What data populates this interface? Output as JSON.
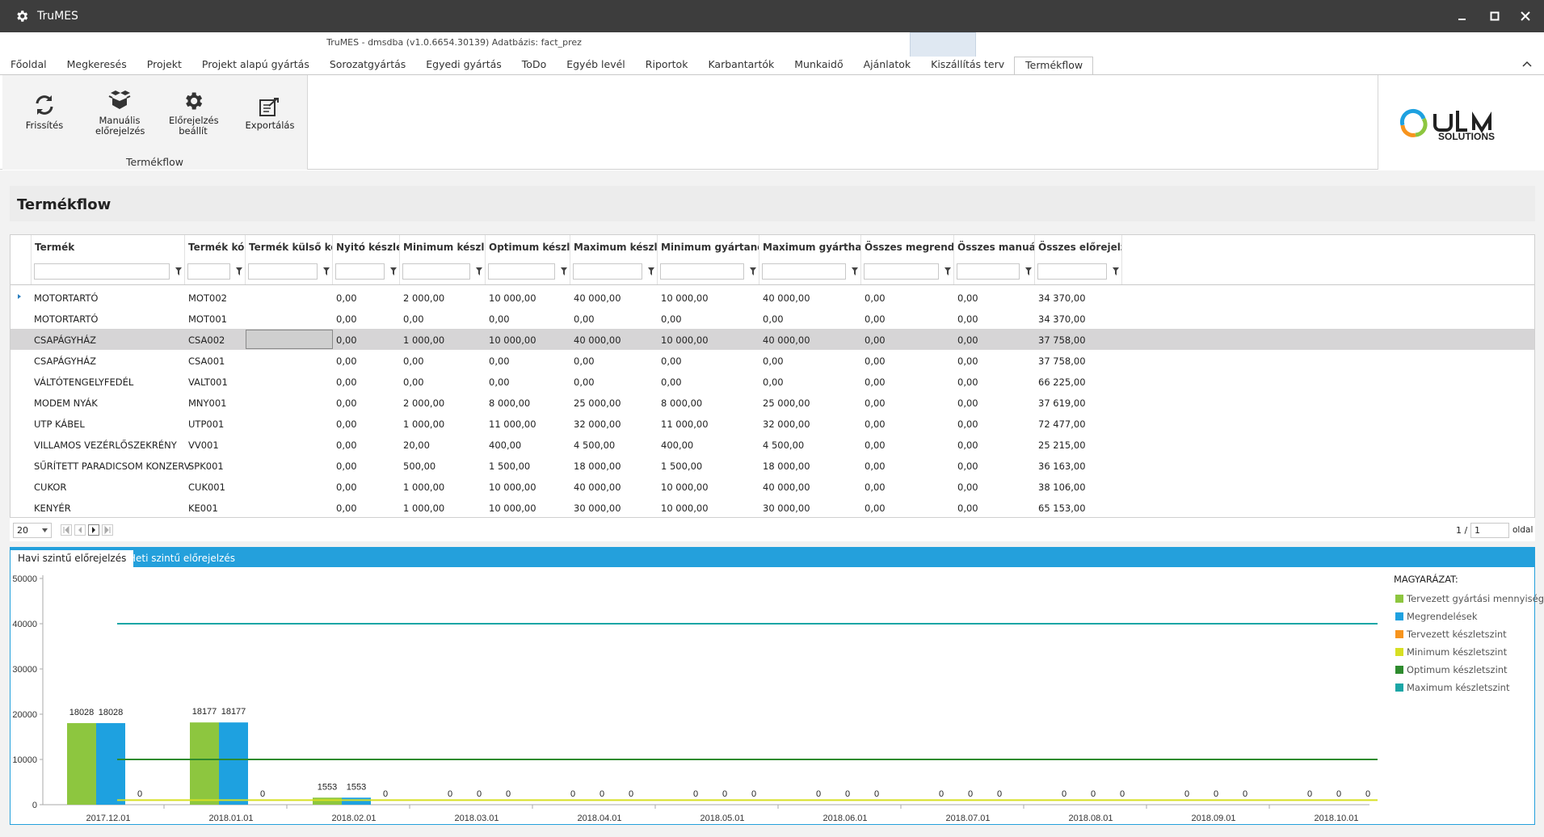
{
  "window": {
    "title": "TruMES"
  },
  "app_subtitle": "TruMES - dmsdba (v1.0.6654.30139) Adatbázis: fact_prez",
  "tabs": [
    {
      "label": "Főoldal"
    },
    {
      "label": "Megkeresés"
    },
    {
      "label": "Projekt"
    },
    {
      "label": "Projekt alapú gyártás"
    },
    {
      "label": "Sorozatgyártás"
    },
    {
      "label": "Egyedi gyártás"
    },
    {
      "label": "ToDo"
    },
    {
      "label": "Egyéb levél"
    },
    {
      "label": "Riportok"
    },
    {
      "label": "Karbantartók"
    },
    {
      "label": "Munkaidő"
    },
    {
      "label": "Ajánlatok"
    },
    {
      "label": "Kiszállítás terv"
    },
    {
      "label": "Termékflow"
    }
  ],
  "active_tab": "Termékflow",
  "ribbon": {
    "buttons": [
      {
        "label": "Frissítés",
        "icon": "refresh-icon"
      },
      {
        "label": "Manuális előrejelzés",
        "icon": "boxes-icon"
      },
      {
        "label": "Előrejelzés beállít",
        "icon": "gear-icon"
      },
      {
        "label": "Exportálás",
        "icon": "export-icon"
      }
    ],
    "group_label": "Termékflow"
  },
  "logo": {
    "text": "SOLUTIONS"
  },
  "panel": {
    "title": "Termékflow"
  },
  "grid": {
    "columns": [
      "Termék",
      "Termék kód",
      "Termék külső kód",
      "Nyitó készlet",
      "Minimum készlet",
      "Optimum készlet",
      "Maximum készlet",
      "Minimum gyártandó",
      "Maximum gyártható",
      "Összes megrendelt",
      "Összes manuális",
      "Összes előrejelzés"
    ],
    "rows": [
      [
        "MOTORTARTÓ",
        "MOT002",
        "",
        "0,00",
        "2 000,00",
        "10 000,00",
        "40 000,00",
        "10 000,00",
        "40 000,00",
        "0,00",
        "0,00",
        "34 370,00"
      ],
      [
        "MOTORTARTÓ",
        "MOT001",
        "",
        "0,00",
        "0,00",
        "0,00",
        "0,00",
        "0,00",
        "0,00",
        "0,00",
        "0,00",
        "34 370,00"
      ],
      [
        "CSAPÁGYHÁZ",
        "CSA002",
        "",
        "0,00",
        "1 000,00",
        "10 000,00",
        "40 000,00",
        "10 000,00",
        "40 000,00",
        "0,00",
        "0,00",
        "37 758,00"
      ],
      [
        "CSAPÁGYHÁZ",
        "CSA001",
        "",
        "0,00",
        "0,00",
        "0,00",
        "0,00",
        "0,00",
        "0,00",
        "0,00",
        "0,00",
        "37 758,00"
      ],
      [
        "VÁLTÓTENGELYFEDÉL",
        "VALT001",
        "",
        "0,00",
        "0,00",
        "0,00",
        "0,00",
        "0,00",
        "0,00",
        "0,00",
        "0,00",
        "66 225,00"
      ],
      [
        "MODEM NYÁK",
        "MNY001",
        "",
        "0,00",
        "2 000,00",
        "8 000,00",
        "25 000,00",
        "8 000,00",
        "25 000,00",
        "0,00",
        "0,00",
        "37 619,00"
      ],
      [
        "UTP KÁBEL",
        "UTP001",
        "",
        "0,00",
        "1 000,00",
        "11 000,00",
        "32 000,00",
        "11 000,00",
        "32 000,00",
        "0,00",
        "0,00",
        "72 477,00"
      ],
      [
        "VILLAMOS VEZÉRLŐSZEKRÉNY",
        "VV001",
        "",
        "0,00",
        "20,00",
        "400,00",
        "4 500,00",
        "400,00",
        "4 500,00",
        "0,00",
        "0,00",
        "25 215,00"
      ],
      [
        "SŰRÍTETT PARADICSOM KONZERV",
        "SPK001",
        "",
        "0,00",
        "500,00",
        "1 500,00",
        "18 000,00",
        "1 500,00",
        "18 000,00",
        "0,00",
        "0,00",
        "36 163,00"
      ],
      [
        "CUKOR",
        "CUK001",
        "",
        "0,00",
        "1 000,00",
        "10 000,00",
        "40 000,00",
        "10 000,00",
        "40 000,00",
        "0,00",
        "0,00",
        "38 106,00"
      ],
      [
        "KENYÉR",
        "KE001",
        "",
        "0,00",
        "1 000,00",
        "10 000,00",
        "30 000,00",
        "10 000,00",
        "30 000,00",
        "0,00",
        "0,00",
        "65 153,00"
      ]
    ],
    "selected_row": 2
  },
  "pager": {
    "page_size": "20",
    "page_current": "1",
    "page_total_prefix": "1 /",
    "page_suffix": "oldal"
  },
  "chart_tabs": [
    {
      "label": "Havi szintű előrejelzés"
    },
    {
      "label": "Heti szintű előrejelzés"
    }
  ],
  "chart_data": {
    "type": "bar",
    "categories": [
      "2017.12.01",
      "2018.01.01",
      "2018.02.01",
      "2018.03.01",
      "2018.04.01",
      "2018.05.01",
      "2018.06.01",
      "2018.07.01",
      "2018.08.01",
      "2018.09.01",
      "2018.10.01"
    ],
    "ylim": [
      0,
      50000
    ],
    "yticks": [
      0,
      10000,
      20000,
      30000,
      40000,
      50000
    ],
    "legend_title": "MAGYARÁZAT:",
    "legend_position": "right",
    "series": [
      {
        "name": "Tervezett gyártási mennyiség",
        "color": "#8dc63f",
        "kind": "bar",
        "values": [
          18028,
          18177,
          1553,
          0,
          0,
          0,
          0,
          0,
          0,
          0,
          0
        ]
      },
      {
        "name": "Megrendelések",
        "color": "#1ea1e0",
        "kind": "bar",
        "values": [
          18028,
          18177,
          1553,
          0,
          0,
          0,
          0,
          0,
          0,
          0,
          0
        ]
      },
      {
        "name": "Tervezett készletszint",
        "color": "#f7941d",
        "kind": "bar",
        "values": [
          0,
          0,
          0,
          0,
          0,
          0,
          0,
          0,
          0,
          0,
          0
        ]
      },
      {
        "name": "Minimum készletszint",
        "color": "#d7df23",
        "kind": "line",
        "values": [
          1000,
          1000,
          1000,
          1000,
          1000,
          1000,
          1000,
          1000,
          1000,
          1000,
          1000
        ]
      },
      {
        "name": "Optimum készletszint",
        "color": "#2e8b2e",
        "kind": "line",
        "values": [
          10000,
          10000,
          10000,
          10000,
          10000,
          10000,
          10000,
          10000,
          10000,
          10000,
          10000
        ]
      },
      {
        "name": "Maximum készletszint",
        "color": "#1ba6a6",
        "kind": "line",
        "values": [
          40000,
          40000,
          40000,
          40000,
          40000,
          40000,
          40000,
          40000,
          40000,
          40000,
          40000
        ]
      }
    ]
  }
}
